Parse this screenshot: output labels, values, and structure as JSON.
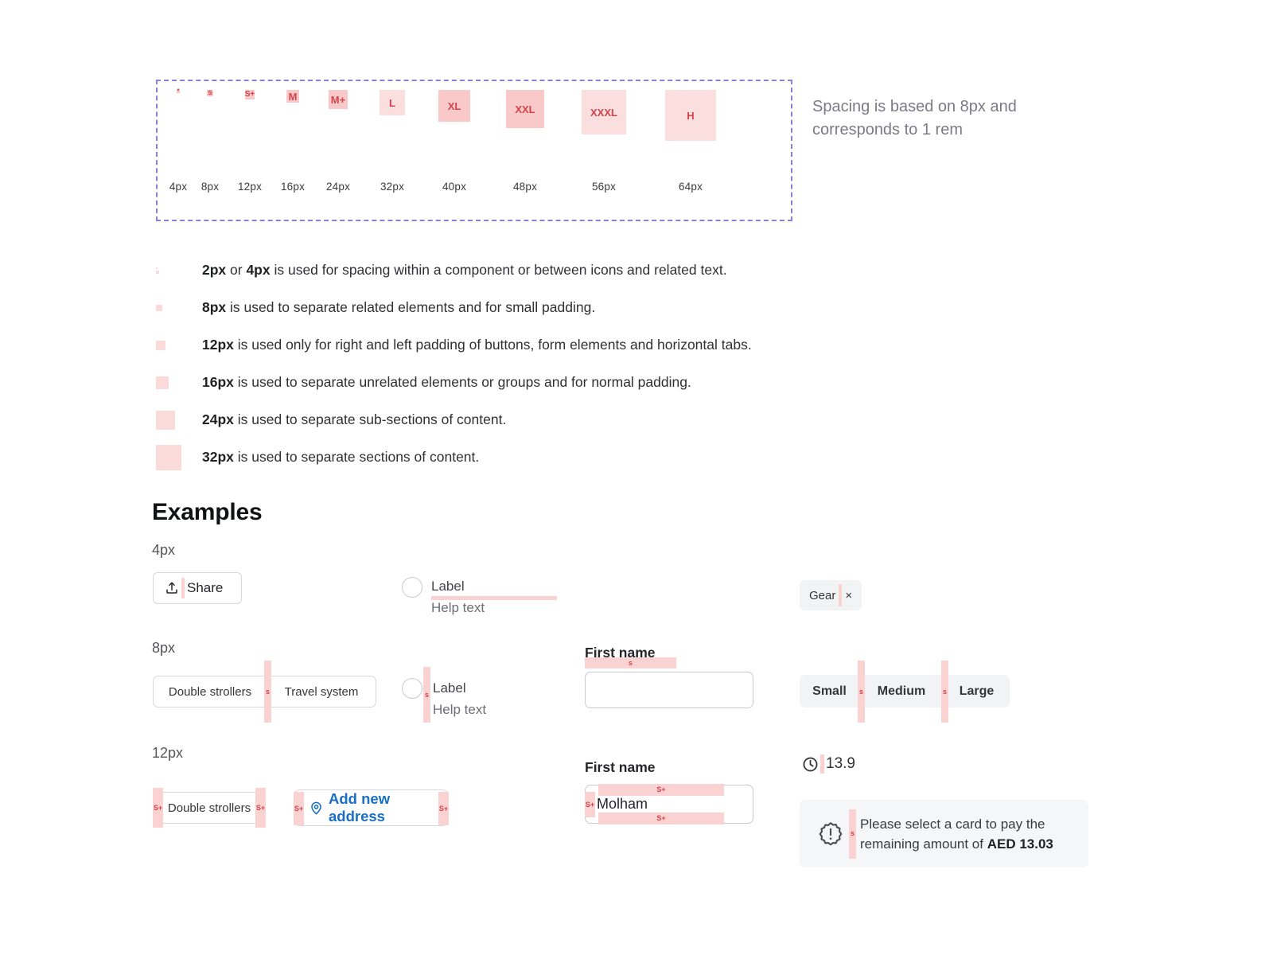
{
  "scale": {
    "note": "Spacing is based on 8px and corresponds to 1 rem",
    "steps": [
      {
        "name": "*",
        "px_label": "4px",
        "size": 4,
        "shade": "dark"
      },
      {
        "name": "s",
        "px_label": "8px",
        "size": 8,
        "shade": "dark"
      },
      {
        "name": "S+",
        "px_label": "12px",
        "size": 12,
        "shade": "dark"
      },
      {
        "name": "M",
        "px_label": "16px",
        "size": 16,
        "shade": "dark"
      },
      {
        "name": "M+",
        "px_label": "24px",
        "size": 24,
        "shade": "dark"
      },
      {
        "name": "L",
        "px_label": "32px",
        "size": 32,
        "shade": "light"
      },
      {
        "name": "XL",
        "px_label": "40px",
        "size": 40,
        "shade": "dark"
      },
      {
        "name": "XXL",
        "px_label": "48px",
        "size": 48,
        "shade": "dark"
      },
      {
        "name": "XXXL",
        "px_label": "56px",
        "size": 56,
        "shade": "light"
      },
      {
        "name": "H",
        "px_label": "64px",
        "size": 64,
        "shade": "light"
      }
    ]
  },
  "rules": [
    {
      "swatches": [
        2,
        4
      ],
      "strong": "2px",
      "mid": " or ",
      "strong2": "4px",
      "text": " is used for spacing within a component or between icons and related text."
    },
    {
      "swatches": [
        8
      ],
      "strong": "8px",
      "text": " is used to separate related elements and for small padding."
    },
    {
      "swatches": [
        12
      ],
      "strong": "12px",
      "text": " is used only for right and left padding of buttons, form elements and horizontal tabs."
    },
    {
      "swatches": [
        16
      ],
      "strong": "16px",
      "text": " is used to separate unrelated elements or groups and for normal padding."
    },
    {
      "swatches": [
        24
      ],
      "strong": "24px",
      "text": " is used to separate sub-sections of content."
    },
    {
      "swatches": [
        32
      ],
      "strong": "32px",
      "text": " is used to separate sections of content."
    }
  ],
  "examples": {
    "title": "Examples",
    "row_4px": {
      "label": "4px",
      "share_button": "Share",
      "radio_label": "Label",
      "radio_help": "Help text",
      "tag_text": "Gear",
      "tag_close": "×"
    },
    "row_8px": {
      "label": "8px",
      "chip_one": "Double strollers",
      "chip_two": "Travel system",
      "marker": "s",
      "radio_label": "Label",
      "radio_help": "Help text",
      "field_label": "First name",
      "segments": [
        "Small",
        "Medium",
        "Large"
      ]
    },
    "row_12px": {
      "label": "12px",
      "marker": "S+",
      "chip_one": "Double strollers",
      "address_button": "Add new address",
      "field_label": "First name",
      "field_value": "Molham",
      "metric_value": "13.9",
      "alert_line1": "Please select a card to pay the",
      "alert_line2_pre": "remaining amount of ",
      "alert_line2_strong": "AED 13.03"
    }
  },
  "colors": {
    "swatch_dark": "#f9c9c9",
    "swatch_light": "#fbdede",
    "marker": "#fbd2d2",
    "marker_text": "#d4424a",
    "dashed_border": "#8b80d6",
    "link_blue": "#1a6fc4"
  }
}
